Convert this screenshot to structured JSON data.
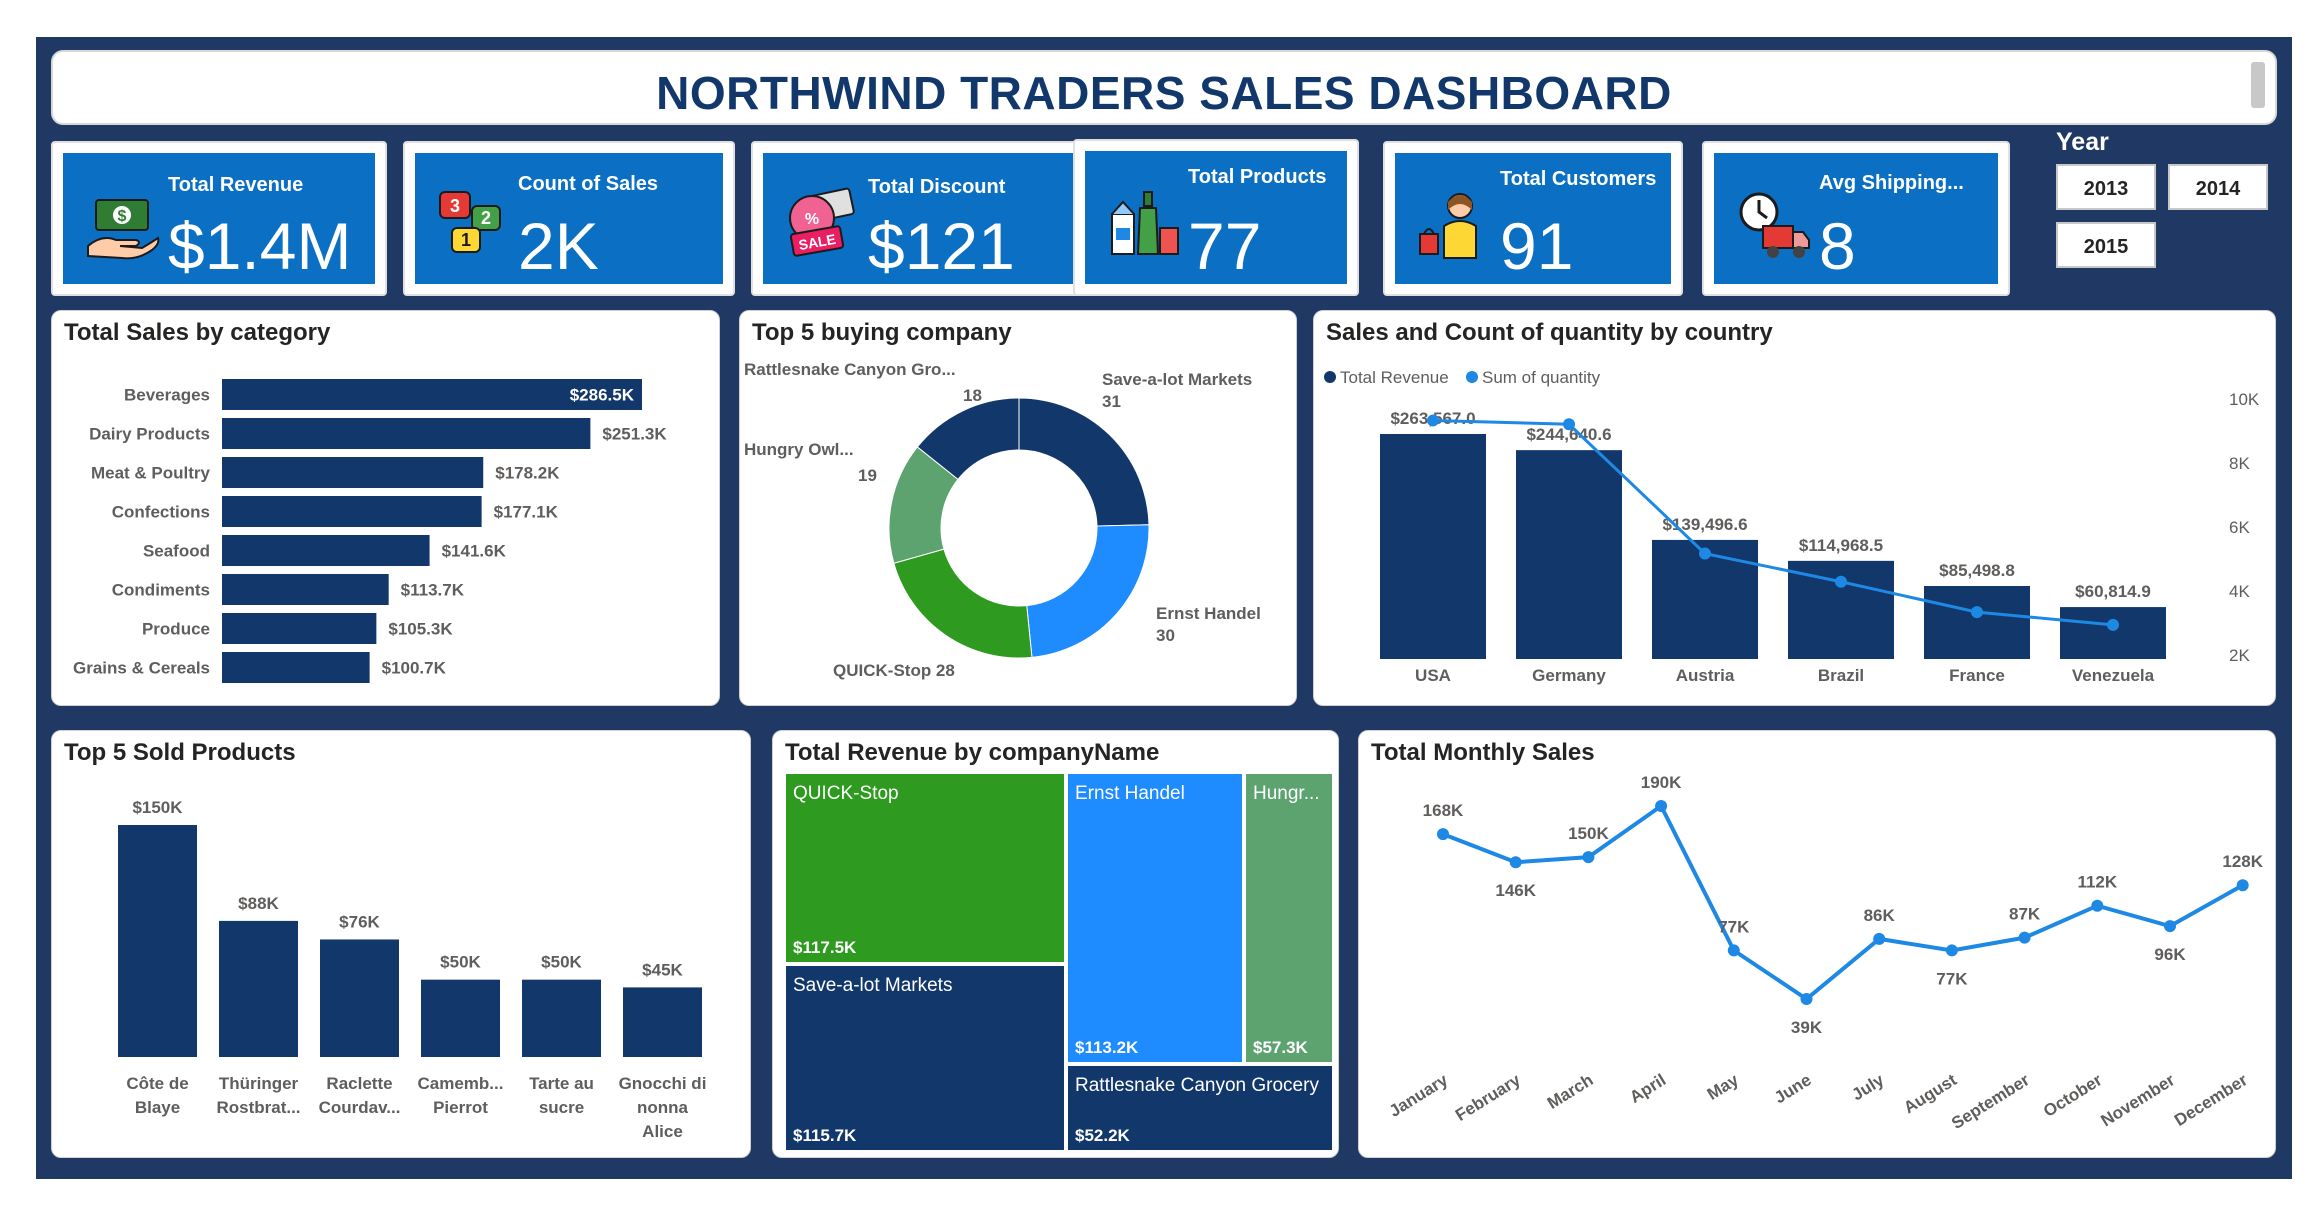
{
  "title": "NORTHWIND TRADERS SALES DASHBOARD",
  "colors": {
    "navy": "#1f3864",
    "kpi_blue": "#0b6fc4",
    "bar": "#12386b",
    "line": "#1e88e5",
    "green": "#2e9a1f",
    "light_blue": "#1e8bff",
    "sage": "#5ca370"
  },
  "kpis": [
    {
      "label": "Total Revenue",
      "value": "$1.4M",
      "icon": "money-hand-icon"
    },
    {
      "label": "Count of Sales",
      "value": "2K",
      "icon": "chat-numbers-icon"
    },
    {
      "label": "Total Discount",
      "value": "$121",
      "icon": "sale-tag-icon"
    },
    {
      "label": "Total Products",
      "value": "77",
      "icon": "grocery-products-icon"
    },
    {
      "label": "Total Customers",
      "value": "91",
      "icon": "shopper-icon"
    },
    {
      "label": "Avg Shipping...",
      "value": "8",
      "icon": "delivery-truck-icon"
    }
  ],
  "year_filter": {
    "label": "Year",
    "options": [
      "2013",
      "2014",
      "2015"
    ]
  },
  "chart_data": [
    {
      "type": "bar",
      "title": "Total Sales by category",
      "categories": [
        "Beverages",
        "Dairy Products",
        "Meat & Poultry",
        "Confections",
        "Seafood",
        "Condiments",
        "Produce",
        "Grains & Cereals"
      ],
      "values": [
        286.5,
        251.3,
        178.2,
        177.1,
        141.6,
        113.7,
        105.3,
        100.7
      ],
      "value_labels": [
        "$286.5K",
        "$251.3K",
        "$178.2K",
        "$177.1K",
        "$141.6K",
        "$113.7K",
        "$105.3K",
        "$100.7K"
      ],
      "orientation": "horizontal"
    },
    {
      "type": "pie",
      "title": "Top 5 buying company",
      "labels": [
        "Save-a-lot Markets",
        "Ernst Handel",
        "QUICK-Stop",
        "Hungry Owl...",
        "Rattlesnake Canyon Gro..."
      ],
      "values": [
        31,
        30,
        28,
        19,
        18
      ],
      "colors": [
        "#12386b",
        "#1e8bff",
        "#2e9a1f",
        "#5ca370",
        "#12386b"
      ],
      "donut": true
    },
    {
      "type": "bar",
      "title": "Sales and Count of quantity by country",
      "legend": [
        "Total Revenue",
        "Sum of quantity"
      ],
      "categories": [
        "USA",
        "Germany",
        "Austria",
        "Brazil",
        "France",
        "Venezuela"
      ],
      "series": [
        {
          "name": "Total Revenue",
          "values": [
            263567.0,
            244640.6,
            139496.6,
            114968.5,
            85498.8,
            60814.9
          ],
          "labels": [
            "$263,567.0",
            "$244,640.6",
            "$139,496.6",
            "$114,968.5",
            "$85,498.8",
            "$60,814.9"
          ]
        },
        {
          "name": "Sum of quantity",
          "values": [
            9330,
            9210,
            5170,
            4290,
            3340,
            2940
          ]
        }
      ],
      "y2_ticks": [
        "10K",
        "8K",
        "6K",
        "4K",
        "2K"
      ],
      "y2lim": [
        2000,
        10000
      ]
    },
    {
      "type": "bar",
      "title": "Top 5 Sold Products",
      "categories": [
        [
          "Côte de",
          "Blaye"
        ],
        [
          "Thüringer",
          "Rostbrat..."
        ],
        [
          "Raclette",
          "Courdav..."
        ],
        [
          "Camemb...",
          "Pierrot"
        ],
        [
          "Tarte au",
          "sucre"
        ],
        [
          "Gnocchi di",
          "nonna",
          "Alice"
        ]
      ],
      "values": [
        150,
        88,
        76,
        50,
        50,
        45
      ],
      "value_labels": [
        "$150K",
        "$88K",
        "$76K",
        "$50K",
        "$50K",
        "$45K"
      ]
    },
    {
      "type": "heatmap",
      "title": "Total Revenue by companyName",
      "tiles": [
        {
          "name": "QUICK-Stop",
          "value": "$117.5K"
        },
        {
          "name": "Save-a-lot Markets",
          "value": "$115.7K"
        },
        {
          "name": "Ernst Handel",
          "value": "$113.2K"
        },
        {
          "name": "Hungr...",
          "value": "$57.3K"
        },
        {
          "name": "Rattlesnake Canyon Grocery",
          "value": "$52.2K"
        }
      ]
    },
    {
      "type": "line",
      "title": "Total Monthly Sales",
      "categories": [
        "January",
        "February",
        "March",
        "April",
        "May",
        "June",
        "July",
        "August",
        "September",
        "October",
        "November",
        "December"
      ],
      "values": [
        168,
        146,
        150,
        190,
        77,
        39,
        86,
        77,
        87,
        112,
        96,
        128
      ],
      "value_labels": [
        "168K",
        "146K",
        "150K",
        "190K",
        "77K",
        "39K",
        "86K",
        "77K",
        "87K",
        "112K",
        "96K",
        "128K"
      ]
    }
  ]
}
